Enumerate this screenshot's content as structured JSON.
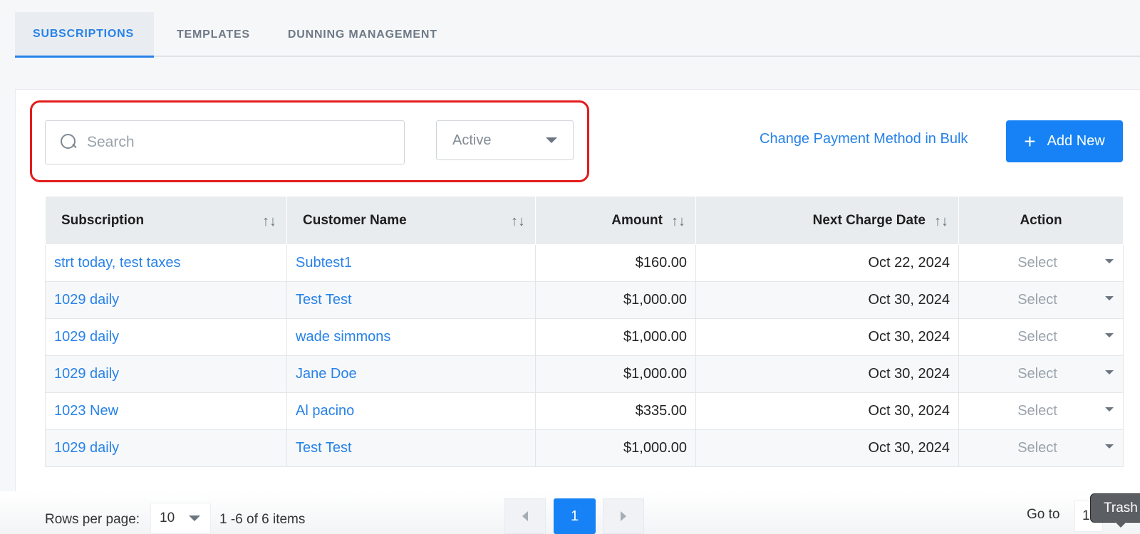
{
  "tabs": [
    {
      "label": "SUBSCRIPTIONS",
      "active": true
    },
    {
      "label": "TEMPLATES",
      "active": false
    },
    {
      "label": "DUNNING MANAGEMENT",
      "active": false
    }
  ],
  "filters": {
    "search_placeholder": "Search",
    "search_value": "",
    "status_value": "Active"
  },
  "actions": {
    "bulk_change_label": "Change Payment Method in Bulk",
    "add_new_label": "Add New"
  },
  "table": {
    "headers": {
      "subscription": "Subscription",
      "customer": "Customer Name",
      "amount": "Amount",
      "next_charge": "Next Charge Date",
      "action": "Action"
    },
    "sort_icon": "↑↓",
    "action_placeholder": "Select",
    "rows": [
      {
        "subscription": "strt today, test taxes",
        "customer": "Subtest1",
        "amount": "$160.00",
        "next_charge": "Oct 22, 2024"
      },
      {
        "subscription": "1029 daily",
        "customer": "Test Test",
        "amount": "$1,000.00",
        "next_charge": "Oct 30, 2024"
      },
      {
        "subscription": "1029 daily",
        "customer": "wade simmons",
        "amount": "$1,000.00",
        "next_charge": "Oct 30, 2024"
      },
      {
        "subscription": "1029 daily",
        "customer": "Jane Doe",
        "amount": "$1,000.00",
        "next_charge": "Oct 30, 2024"
      },
      {
        "subscription": "1023 New",
        "customer": "Al pacino",
        "amount": "$335.00",
        "next_charge": "Oct 30, 2024"
      },
      {
        "subscription": "1029 daily",
        "customer": "Test Test",
        "amount": "$1,000.00",
        "next_charge": "Oct 30, 2024"
      }
    ]
  },
  "pagination": {
    "rows_per_page_label": "Rows per page:",
    "rows_per_page_value": "10",
    "range_text": "1 -6 of 6  items",
    "current_page": "1",
    "goto_label": "Go to",
    "goto_value": "1"
  },
  "tooltip": {
    "text": "Trash"
  },
  "colors": {
    "accent": "#1682f5",
    "link": "#2782e8",
    "highlight_border": "#e31c1c"
  }
}
